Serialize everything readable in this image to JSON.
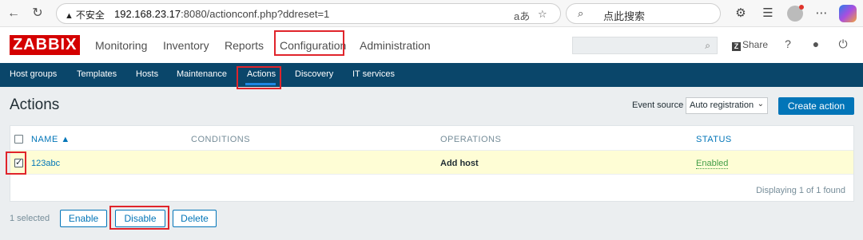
{
  "browser": {
    "security_label": "不安全",
    "url_host": "192.168.23.17",
    "url_rest": ":8080/actionconf.php?ddreset=1",
    "read_aloud": "aあ",
    "search_placeholder": "点此搜索"
  },
  "header": {
    "logo": "ZABBIX",
    "menu": [
      "Monitoring",
      "Inventory",
      "Reports",
      "Configuration",
      "Administration"
    ],
    "share_label": "Share",
    "help": "?"
  },
  "submenu": {
    "items": [
      "Host groups",
      "Templates",
      "Hosts",
      "Maintenance",
      "Actions",
      "Discovery",
      "IT services"
    ],
    "active": "Actions"
  },
  "page": {
    "title": "Actions",
    "event_source_label": "Event source",
    "event_source_value": "Auto registration",
    "create_button": "Create action"
  },
  "table": {
    "columns": {
      "name": "NAME ▲",
      "conditions": "CONDITIONS",
      "operations": "OPERATIONS",
      "status": "STATUS"
    },
    "rows": [
      {
        "name": "123abc",
        "conditions": "",
        "operations": "Add host",
        "status": "Enabled",
        "checked": true
      }
    ],
    "footer": "Displaying 1 of 1 found"
  },
  "actions_bar": {
    "selected_count": "1 selected",
    "enable": "Enable",
    "disable": "Disable",
    "delete": "Delete"
  },
  "colors": {
    "brand_red": "#d40000",
    "nav_blue": "#0a466a",
    "accent_blue": "#0275b8",
    "selected_row": "#fefdd5",
    "status_green": "#429e47",
    "highlight_box": "#e0242b"
  }
}
